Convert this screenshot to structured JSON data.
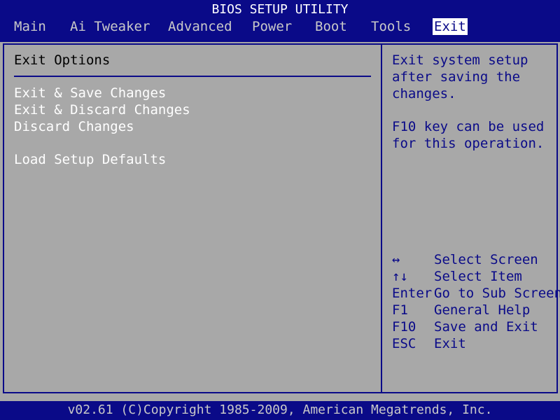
{
  "title": "BIOS SETUP UTILITY",
  "tabs": [
    {
      "label": "Main"
    },
    {
      "label": "Ai Tweaker"
    },
    {
      "label": "Advanced"
    },
    {
      "label": "Power"
    },
    {
      "label": "Boot"
    },
    {
      "label": "Tools"
    },
    {
      "label": "Exit",
      "selected": true
    }
  ],
  "panel": {
    "title": "Exit Options",
    "options": [
      {
        "label": "Exit & Save Changes"
      },
      {
        "label": "Exit & Discard Changes"
      },
      {
        "label": "Discard Changes"
      },
      {
        "label": "Load Setup Defaults"
      }
    ]
  },
  "help": {
    "lines": [
      "Exit system setup",
      "after saving the",
      "changes.",
      "F10 key can be used",
      "for this operation."
    ]
  },
  "keys": [
    {
      "key": "↔",
      "action": "Select Screen"
    },
    {
      "key": "↑↓",
      "action": "Select Item"
    },
    {
      "key": "Enter",
      "action": "Go to Sub Screen"
    },
    {
      "key": "F1",
      "action": "General Help"
    },
    {
      "key": "F10",
      "action": "Save and Exit"
    },
    {
      "key": "ESC",
      "action": "Exit"
    }
  ],
  "footer": "v02.61 (C)Copyright 1985-2009, American Megatrends, Inc.",
  "colors": {
    "bar_blue": "#0a0a88",
    "body_grey": "#a8a8a8",
    "selected_tab_bg": "#ffffff",
    "option_text": "#ffffff",
    "help_text": "#0a0a88"
  }
}
